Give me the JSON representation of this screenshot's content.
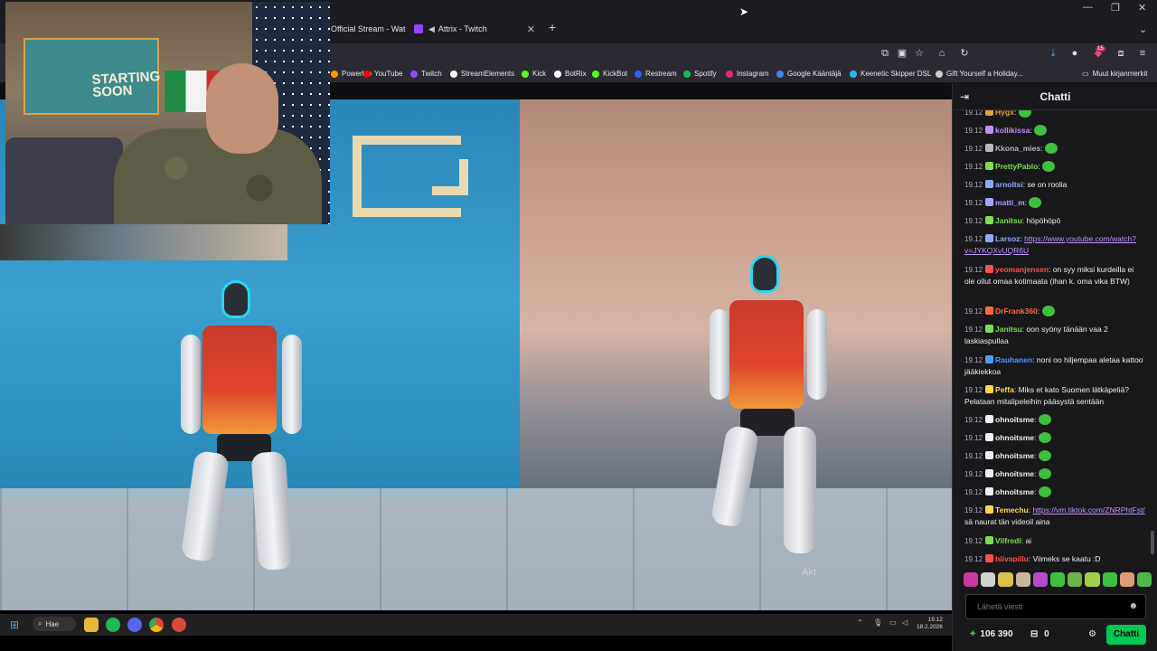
{
  "browser": {
    "tabs": [
      {
        "label": "Official Stream - Wat",
        "color": "#d23c3c"
      },
      {
        "label": "Attrix - Twitch",
        "color": "#9146ff"
      }
    ],
    "bookmarks": [
      {
        "label": "PowerUp",
        "color": "#ff9800"
      },
      {
        "label": "YouTube",
        "color": "#ff0000"
      },
      {
        "label": "Twitch",
        "color": "#9146ff"
      },
      {
        "label": "StreamElements",
        "color": "#ffffff"
      },
      {
        "label": "Kick",
        "color": "#53fc18"
      },
      {
        "label": "BotRix",
        "color": "#ffffff"
      },
      {
        "label": "KickBot",
        "color": "#53fc18"
      },
      {
        "label": "Restream",
        "color": "#2962ff"
      },
      {
        "label": "Spotify",
        "color": "#1db954"
      },
      {
        "label": "Instagram",
        "color": "#e1306c"
      },
      {
        "label": "Google Kääntäjä",
        "color": "#4285f4"
      },
      {
        "label": "Keenetic Skipper DSL",
        "color": "#29b6f6"
      },
      {
        "label": "Gift Yourself a Holiday...",
        "color": "#cccccc"
      }
    ],
    "other_bookmarks": "Muut kirjanmerkit",
    "notification_count": "15"
  },
  "webcam": {
    "poster_text": "STARTING SOON"
  },
  "video": {
    "watermark": "Akt"
  },
  "chat": {
    "title": "Chatti",
    "messages": [
      {
        "time": "19.12",
        "user": "Hygx",
        "color": "#e0a040",
        "text": "",
        "emote": true
      },
      {
        "time": "19.12",
        "user": "kollikissa",
        "color": "#c48cff",
        "text": "",
        "emote": true
      },
      {
        "time": "19.12",
        "user": "Kkona_mies",
        "color": "#b5b5c0",
        "text": "",
        "emote": true
      },
      {
        "time": "19.12",
        "user": "PrettyPablo",
        "color": "#7cdd52",
        "text": "",
        "emote": true
      },
      {
        "time": "19.12",
        "user": "arnoltsi",
        "color": "#8fa8ff",
        "text": "se on roolia",
        "emote": false
      },
      {
        "time": "19.12",
        "user": "matti_m",
        "color": "#a5a5ff",
        "text": "",
        "emote": true
      },
      {
        "time": "19.12",
        "user": "Janitsu",
        "color": "#7cdd52",
        "text": "höpöhöpö",
        "emote": false
      },
      {
        "time": "19.12",
        "user": "Larsoz",
        "color": "#8fa8ff",
        "link": "https://www.youtube.com/watch?v=JYKQXvUQR6U",
        "text": "",
        "emote": false
      },
      {
        "time": "19.12",
        "user": "yeomanjensen",
        "color": "#ff4f4f",
        "text": "on syy miksi kurdeilla ei ole ollut omaa kotimaata (ihan k. oma vika BTW)",
        "emote": false
      },
      {
        "time": "19.12",
        "user": "DrFrank360",
        "color": "#ff6a3d",
        "text": "",
        "emote": true
      },
      {
        "time": "19.12",
        "user": "Janitsu",
        "color": "#7cdd52",
        "text": "oon syöny tänään vaa 2 laskiaspullaa",
        "emote": false
      },
      {
        "time": "19.12",
        "user": "Rauhanen",
        "color": "#4f9bff",
        "text": "noni oo hiljempaa aletaa kattoo jääkiekkoa",
        "emote": false
      },
      {
        "time": "19.12",
        "user": "Peffa",
        "color": "#ffd54f",
        "text": "Miks et kato Suomen lätkäpeliä? Pelataan mitalipeleihin pääsystä sentään",
        "emote": false
      },
      {
        "time": "19.12",
        "user": "ohnoitsme",
        "color": "#efeff1",
        "text": "",
        "emote": true
      },
      {
        "time": "19.12",
        "user": "ohnoitsme",
        "color": "#efeff1",
        "text": "",
        "emote": true
      },
      {
        "time": "19.12",
        "user": "ohnoitsme",
        "color": "#efeff1",
        "text": "",
        "emote": true
      },
      {
        "time": "19.12",
        "user": "ohnoitsme",
        "color": "#efeff1",
        "text": "",
        "emote": true
      },
      {
        "time": "19.12",
        "user": "ohnoitsme",
        "color": "#efeff1",
        "text": "",
        "emote": true
      },
      {
        "time": "19.12",
        "user": "Temechu",
        "color": "#ffd54f",
        "link": "https://vm.tiktok.com/ZNRPhtFst/",
        "text": "sä naurat tän videoil aina",
        "emote": false
      },
      {
        "time": "19.12",
        "user": "Vilfredi",
        "color": "#7cdd52",
        "text": "ai",
        "emote": false
      },
      {
        "time": "19.12",
        "user": "hiivapillu",
        "color": "#ff4f4f",
        "text": "Viimeks se kaatu :D",
        "emote": false
      }
    ],
    "input_placeholder": "Lähetä viesti",
    "points": "106 390",
    "gift_count": "0",
    "send_label": "Chatti"
  },
  "taskbar": {
    "search_label": "Hae",
    "time": "19.12",
    "date": "18.2.2026"
  }
}
